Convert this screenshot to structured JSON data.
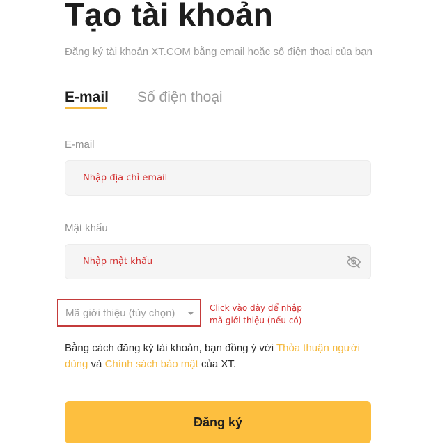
{
  "page": {
    "title": "Tạo tài khoản",
    "subtitle": "Đăng ký tài khoản XT.COM bằng email hoặc số điện thoại của bạn"
  },
  "tabs": [
    {
      "label": "E-mail",
      "active": true
    },
    {
      "label": "Số điện thoại",
      "active": false
    }
  ],
  "form": {
    "email_label": "E-mail",
    "email_placeholder": "Nhập địa chỉ email",
    "email_value": "",
    "password_label": "Mật khẩu",
    "password_placeholder": "Nhập mật khẩu",
    "password_value": "",
    "password_toggle_icon": "eye-slash-icon",
    "referral_label": "Mã giới thiệu (tùy chọn)",
    "referral_icon": "caret-down-icon"
  },
  "annotation": {
    "line1": "Click vào đây để nhập",
    "line2": "mã giới thiệu (nếu có)",
    "color": "#d32f2f"
  },
  "terms": {
    "prefix": "Bằng cách đăng ký tài khoản, bạn đồng ý với ",
    "link1": "Thỏa thuận người dùng",
    "middle": " và ",
    "link2": "Chính sách bảo mật",
    "suffix": " của XT."
  },
  "submit_label": "Đăng ký",
  "colors": {
    "accent": "#fdbf3f",
    "link": "#f5b93e",
    "highlight_border": "#c43b3b"
  }
}
